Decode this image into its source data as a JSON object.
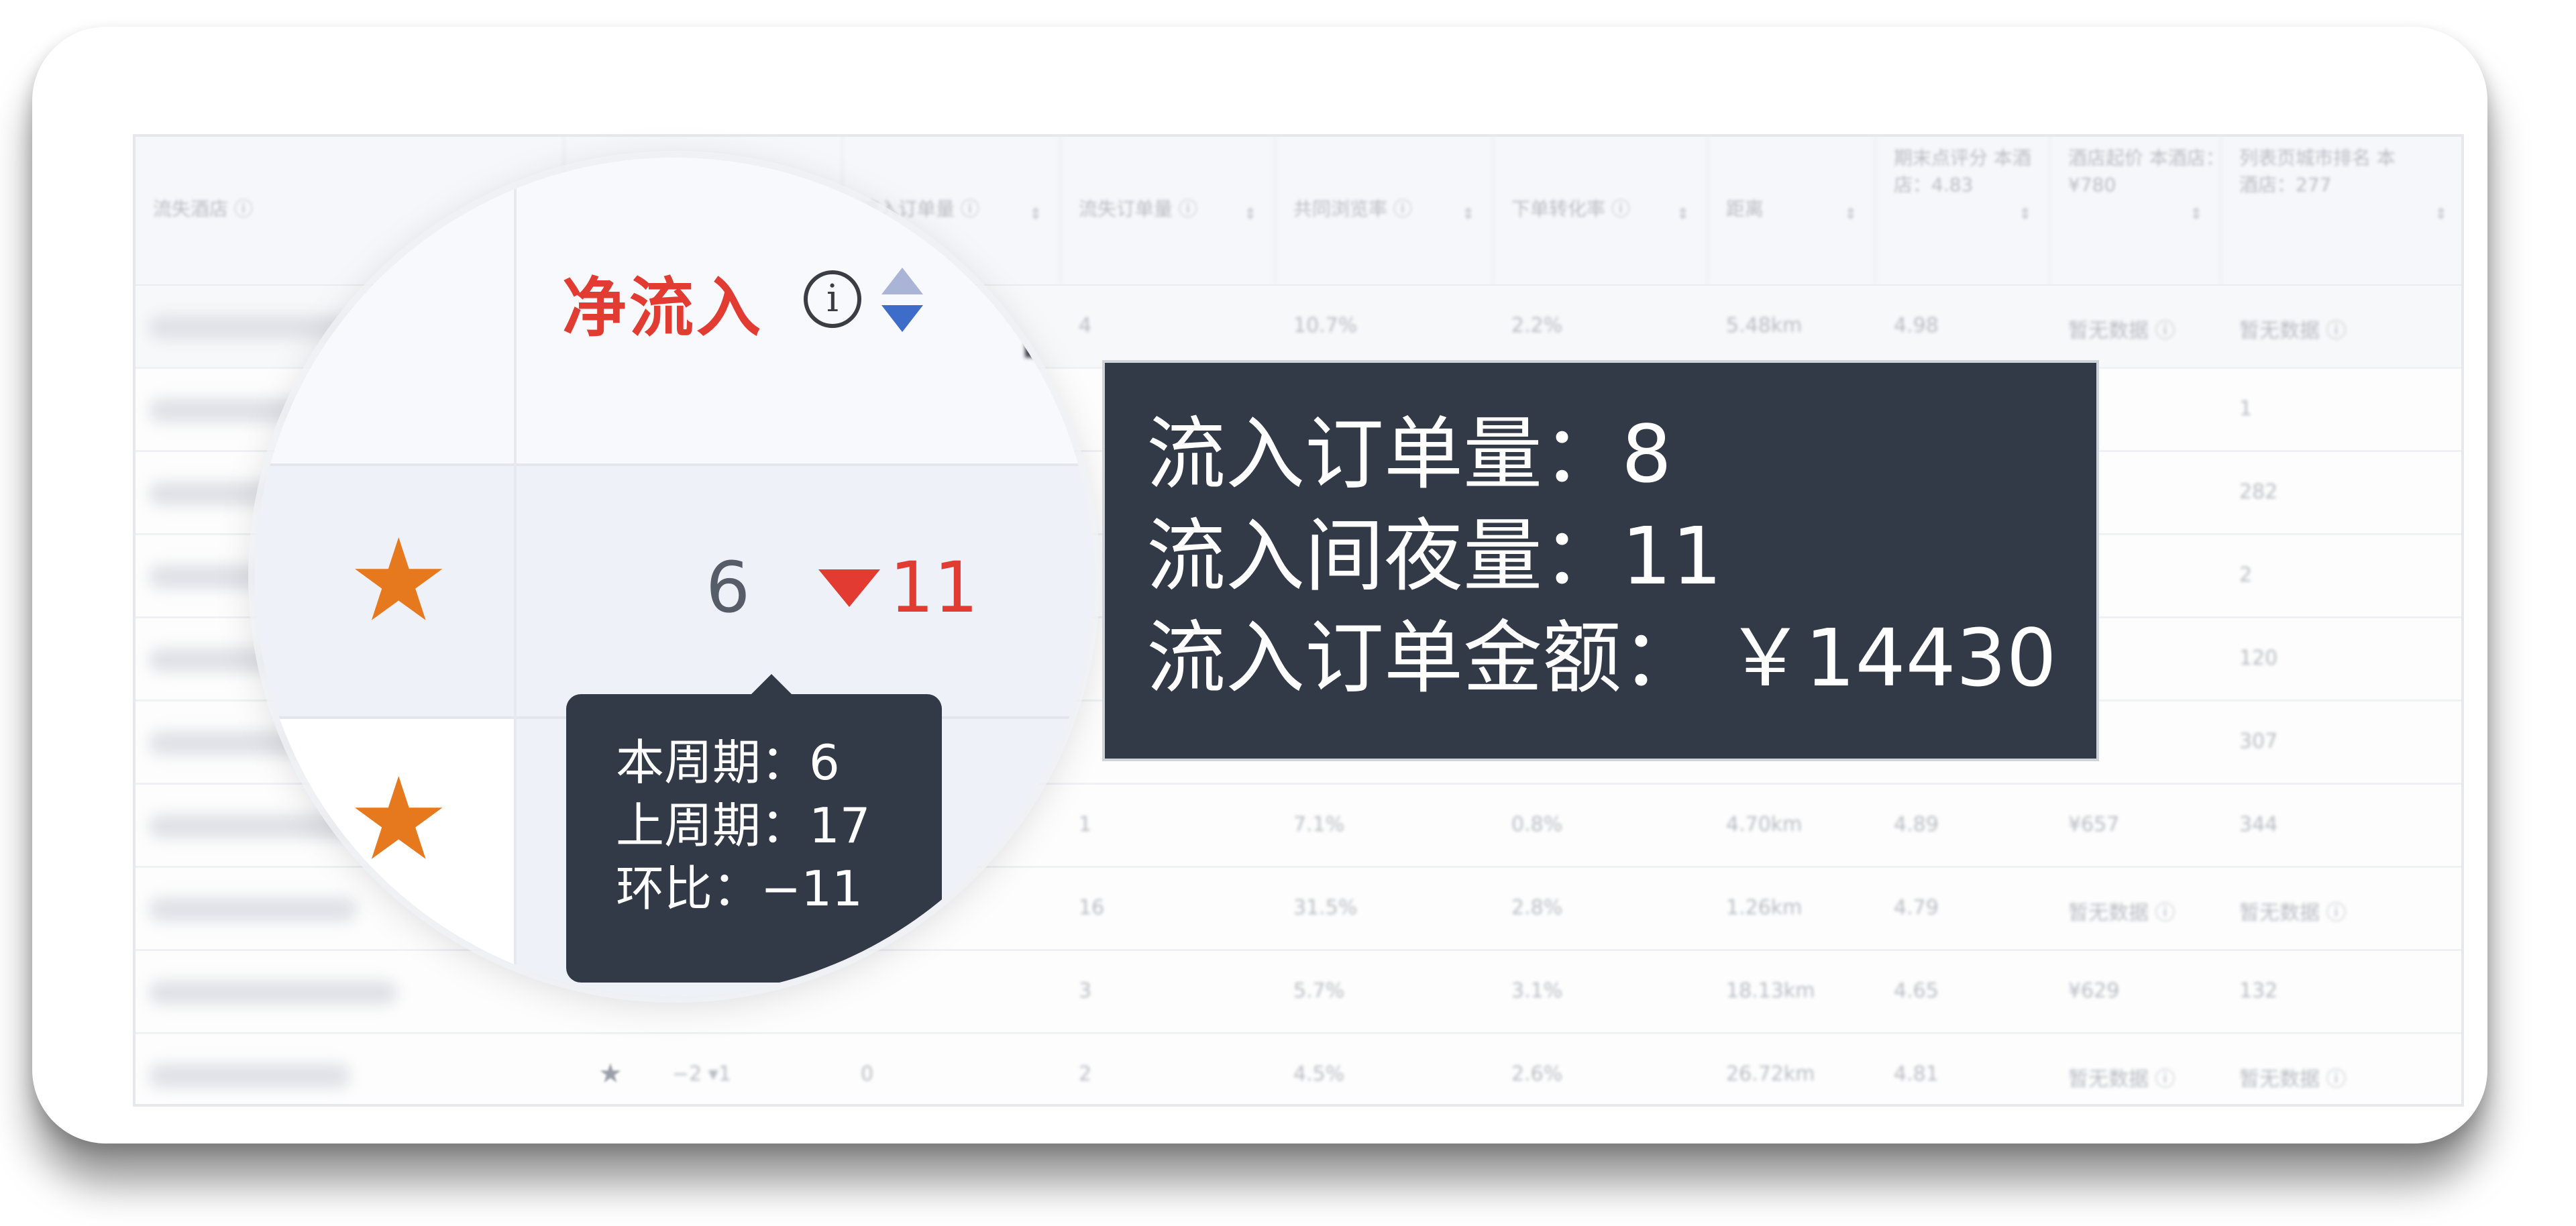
{
  "table": {
    "headers": [
      {
        "label": "流失酒店 ⓘ",
        "multi": false
      },
      {
        "label": "",
        "multi": false
      },
      {
        "label": "流入订单量 ⓘ",
        "multi": false
      },
      {
        "label": "流失订单量 ⓘ",
        "multi": false
      },
      {
        "label": "共同浏览率 ⓘ",
        "multi": false
      },
      {
        "label": "下单转化率 ⓘ",
        "multi": false
      },
      {
        "label": "距离",
        "multi": false
      },
      {
        "label": "期末点评分 本酒店：4.83",
        "multi": true
      },
      {
        "label": "酒店起价 本酒店：¥780",
        "multi": true
      },
      {
        "label": "列表页城市排名 本酒店：277",
        "multi": true
      }
    ],
    "rows": [
      {
        "star": false,
        "net": "",
        "inflow": "",
        "outflow": "4",
        "co_view": "10.7%",
        "conversion": "2.2%",
        "distance": "5.48km",
        "rating": "4.98",
        "price": "暂无数据 ⓘ",
        "rank": "暂无数据 ⓘ"
      },
      {
        "star": false,
        "net": "",
        "inflow": "",
        "outflow": "",
        "co_view": "",
        "conversion": "",
        "distance": "",
        "rating": "",
        "price": "",
        "rank": "1"
      },
      {
        "star": false,
        "net": "",
        "inflow": "",
        "outflow": "",
        "co_view": "",
        "conversion": "",
        "distance": "",
        "rating": "",
        "price": "",
        "rank": "282"
      },
      {
        "star": false,
        "net": "",
        "inflow": "",
        "outflow": "",
        "co_view": "",
        "conversion": "",
        "distance": "",
        "rating": "",
        "price": "",
        "rank": "2"
      },
      {
        "star": false,
        "net": "",
        "inflow": "",
        "outflow": "",
        "co_view": "",
        "conversion": "",
        "distance": "",
        "rating": "",
        "price": "",
        "rank": "120"
      },
      {
        "star": false,
        "net": "",
        "inflow": "",
        "outflow": "",
        "co_view": "",
        "conversion": "",
        "distance": "",
        "rating": "",
        "price": "",
        "rank": "307"
      },
      {
        "star": false,
        "net": "",
        "inflow": "",
        "outflow": "1",
        "co_view": "7.1%",
        "conversion": "0.8%",
        "distance": "4.70km",
        "rating": "4.89",
        "price": "¥657",
        "rank": "344"
      },
      {
        "star": false,
        "net": "",
        "inflow": "",
        "outflow": "16",
        "co_view": "31.5%",
        "conversion": "2.8%",
        "distance": "1.26km",
        "rating": "4.79",
        "price": "暂无数据 ⓘ",
        "rank": "暂无数据 ⓘ"
      },
      {
        "star": false,
        "net": "",
        "inflow": "",
        "outflow": "3",
        "co_view": "5.7%",
        "conversion": "3.1%",
        "distance": "18.13km",
        "rating": "4.65",
        "price": "¥629",
        "rank": "132"
      },
      {
        "star": true,
        "net": "−2 ▾1",
        "inflow": "0",
        "outflow": "2",
        "co_view": "4.5%",
        "conversion": "2.6%",
        "distance": "26.72km",
        "rating": "4.81",
        "price": "暂无数据 ⓘ",
        "rank": "暂无数据 ⓘ"
      }
    ]
  },
  "magnifier": {
    "column_title": "净流入",
    "info_glyph": "i",
    "net_value": "6",
    "net_change": "11",
    "tooltip": {
      "line1": "本周期：6",
      "line2": "上周期：17",
      "line3": "环比：−11"
    },
    "star_glyph": "★",
    "colors": {
      "accent_red": "#e23b32",
      "star_orange": "#e6781e",
      "tooltip_bg": "#333a47"
    }
  },
  "inflow_tooltip": {
    "line1": "流入订单量：8",
    "line2": "流入间夜量：11",
    "line3": "流入订单金额： ￥14430"
  }
}
